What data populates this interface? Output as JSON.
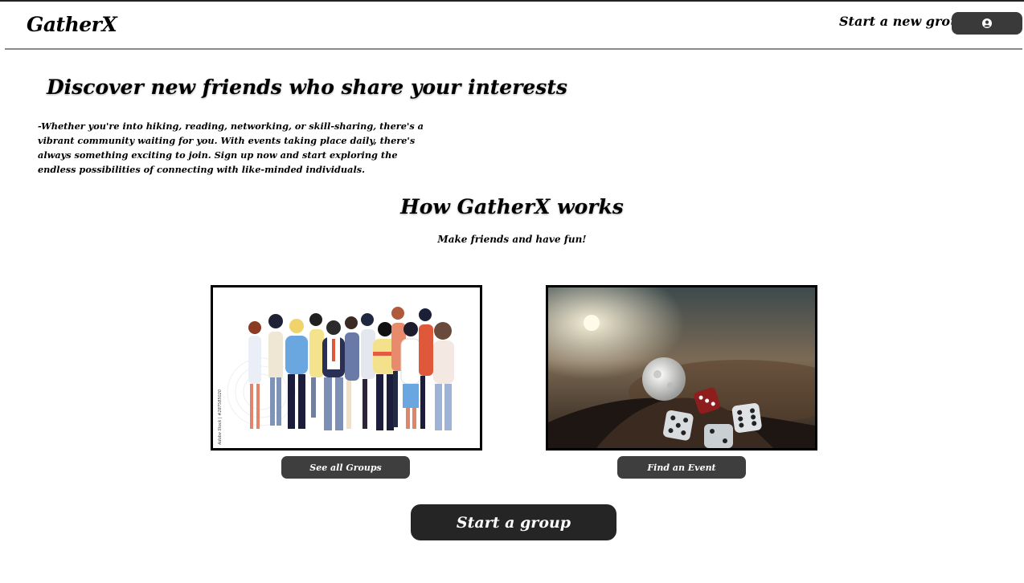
{
  "header": {
    "brand": "GatherX",
    "new_group_link": "Start a new group",
    "profile_icon": "user-circle-icon"
  },
  "hero": {
    "title": "Discover new friends who share your interests",
    "text": "-Whether you're into hiking, reading, networking, or skill-sharing, there's a vibrant community waiting for you. With events taking place daily, there's always something exciting to join. Sign up now and start exploring the endless possibilities of connecting with like-minded individuals."
  },
  "how": {
    "title": "How GatherX works",
    "subtitle": "Make friends and have fun!"
  },
  "cards": {
    "groups": {
      "image": "people-group-illustration",
      "watermark": "Adobe Stock | #287585020",
      "button": "See all Groups"
    },
    "events": {
      "image": "moon-and-dice-photo",
      "button": "Find an Event"
    }
  },
  "cta": {
    "start_group": "Start a group"
  },
  "colors": {
    "button_dark": "#3e3e3e",
    "cta_dark": "#252525",
    "text": "#000000"
  }
}
